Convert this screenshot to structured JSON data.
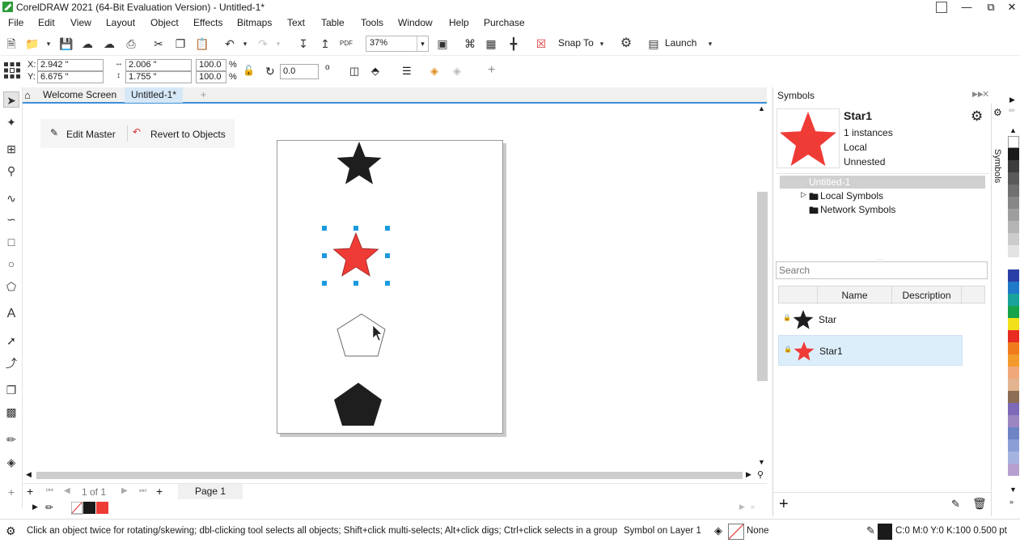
{
  "window": {
    "title": "CorelDRAW 2021 (64-Bit Evaluation Version) - Untitled-1*",
    "minimize": "—",
    "restore": "⧉",
    "close": "✕"
  },
  "menu": [
    "File",
    "Edit",
    "View",
    "Layout",
    "Object",
    "Effects",
    "Bitmaps",
    "Text",
    "Table",
    "Tools",
    "Window",
    "Help",
    "Purchase"
  ],
  "toolbar": {
    "zoom_value": "37%",
    "snap_to_label": "Snap To",
    "launch_label": "Launch"
  },
  "properties": {
    "x_label": "X:",
    "y_label": "Y:",
    "x_value": "2.942 \"",
    "y_value": "6.675 \"",
    "width_value": "2.006 \"",
    "height_value": "1.755 \"",
    "scale_w": "100.0",
    "scale_h": "100.0",
    "percent": "%",
    "rotation_value": "0.0",
    "degree": "o"
  },
  "tabs": {
    "welcome": "Welcome Screen",
    "doc": "Untitled-1*",
    "add": "+"
  },
  "symbol_edit_bar": {
    "edit_master": "Edit Master",
    "revert": "Revert to Objects"
  },
  "page_nav": {
    "page_count": "1 of 1",
    "page_tab": "Page 1"
  },
  "status": {
    "hint": "Click an object twice for rotating/skewing; dbl-clicking tool selects all objects; Shift+click multi-selects; Alt+click digs; Ctrl+click selects in a group",
    "selection": "Symbol on Layer 1",
    "fill": "None",
    "outline": "C:0 M:0 Y:0 K:100  0.500 pt"
  },
  "docker": {
    "title": "Symbols",
    "vertical_tab": "Symbols",
    "selected_name": "Star1",
    "instances": "1 instances",
    "scope": "Local",
    "link": "Unnested",
    "tree": [
      "Untitled-1",
      "Local Symbols",
      "Network Symbols"
    ],
    "search_placeholder": "Search",
    "columns": [
      "",
      "Name",
      "Description"
    ],
    "rows": [
      {
        "name": "Star",
        "color": "#1e1e1e"
      },
      {
        "name": "Star1",
        "color": "#ef3b36"
      }
    ]
  },
  "colors": {
    "accent": "#3c8fd6",
    "symbol_red": "#ef3b36",
    "selection_handle": "#1a9ae0",
    "dark_fill": "#1e1e1e",
    "palette": [
      "#ffffff",
      "#1a1a1a",
      "#3d3d3d",
      "#5a5a5a",
      "#707070",
      "#878787",
      "#9e9e9e",
      "#b5b5b5",
      "#cccccc",
      "#e3e3e3",
      "#ffffff",
      "#2a3fa8",
      "#1f79c9",
      "#18a39c",
      "#17a34a",
      "#f2e11a",
      "#e82c22",
      "#f07b1d",
      "#f29a2c",
      "#f0a87b",
      "#e3b48f",
      "#8c6e55",
      "#7d6ab8",
      "#9b86c2",
      "#6e84c4",
      "#8b9fd6",
      "#a6b3e0",
      "#b6a0cf"
    ]
  }
}
